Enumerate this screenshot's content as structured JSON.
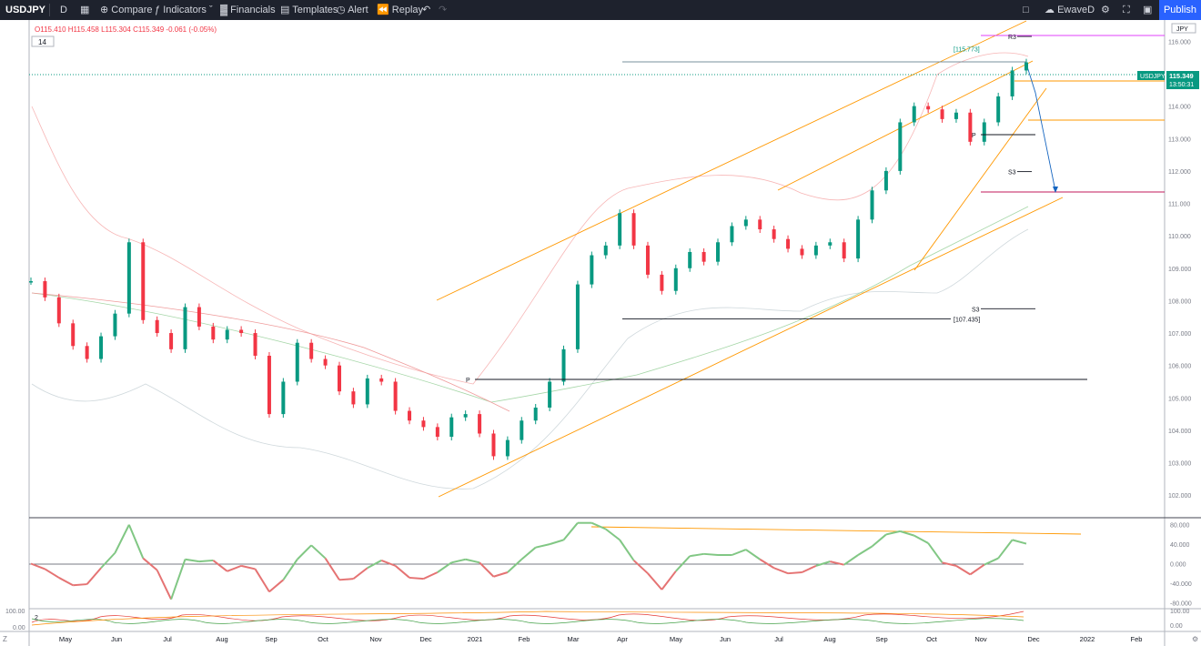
{
  "toolbar": {
    "symbol": "USDJPY",
    "interval": "D",
    "compare": "Compare",
    "indicators": "Indicators",
    "financials": "Financials",
    "templates": "Templates",
    "alert": "Alert",
    "replay": "Replay",
    "layout_name": "EwaveD",
    "publish": "Publish"
  },
  "legend": {
    "ohlc": "O115.410  H115.458  L115.304  C115.349  -0.061  (-0.05%)",
    "indicator_param": "14",
    "osc2_param": "2"
  },
  "chart_data": {
    "type": "line",
    "symbol": "USDJPY",
    "interval": "D",
    "currency_badge": "JPY",
    "last_price": {
      "label": "USDJPY",
      "value": "115.349",
      "countdown": "13:50:31"
    },
    "y_ticks": [
      "116.000",
      "115.000",
      "114.000",
      "113.000",
      "112.000",
      "111.000",
      "110.000",
      "109.000",
      "108.000",
      "107.000",
      "106.000",
      "105.000",
      "104.000",
      "103.000",
      "102.000"
    ],
    "ylim": [
      101.5,
      116.6
    ],
    "x_ticks": [
      "May",
      "Jun",
      "Jul",
      "Aug",
      "Sep",
      "Oct",
      "Nov",
      "Dec",
      "2021",
      "Feb",
      "Mar",
      "Apr",
      "May",
      "Jun",
      "Jul",
      "Aug",
      "Sep",
      "Oct",
      "Nov",
      "Dec",
      "2022",
      "Feb"
    ],
    "series": [
      {
        "values": [
          108.6,
          108.1,
          107.3,
          106.6,
          106.2,
          106.9,
          107.6,
          109.8,
          107.4,
          107.0,
          106.5,
          107.8,
          107.2,
          106.8,
          107.1,
          107.0,
          106.3,
          104.5,
          105.5,
          106.7,
          106.2,
          106.0,
          105.2,
          104.8,
          105.6,
          105.5,
          104.6,
          104.3,
          104.1,
          103.8,
          104.4,
          104.5,
          103.9,
          103.2,
          103.7,
          104.3,
          104.7,
          105.5,
          106.5,
          108.5,
          109.4,
          109.7,
          110.7,
          109.7,
          108.8,
          108.3,
          109.0,
          109.5,
          109.2,
          109.8,
          110.3,
          110.5,
          110.2,
          109.9,
          109.6,
          109.4,
          109.7,
          109.8,
          109.3,
          110.5,
          111.4,
          112.0,
          113.5,
          114.0,
          113.9,
          113.6,
          113.8,
          112.9,
          113.5,
          114.3,
          115.1,
          115.349
        ]
      }
    ],
    "annotations": [
      {
        "text": "R3",
        "value": 116.15
      },
      {
        "text": "[115.773]",
        "value": 115.773
      },
      {
        "text": "P",
        "value": 113.12
      },
      {
        "text": "S3",
        "value": 111.98
      },
      {
        "text": "S3",
        "value": 107.75
      },
      {
        "text": "[107.435]",
        "value": 107.435
      },
      {
        "text": "P",
        "value": 105.57
      }
    ],
    "oscillator": {
      "y_ticks": [
        "80.000",
        "40.000",
        "0.000",
        "-40.000",
        "-80.000"
      ],
      "ylim": [
        -88,
        88
      ]
    },
    "oscillator2": {
      "y_ticks_right": [
        "100.00",
        "0.00"
      ],
      "y_ticks_left": [
        "100.00",
        "0.00"
      ]
    }
  }
}
